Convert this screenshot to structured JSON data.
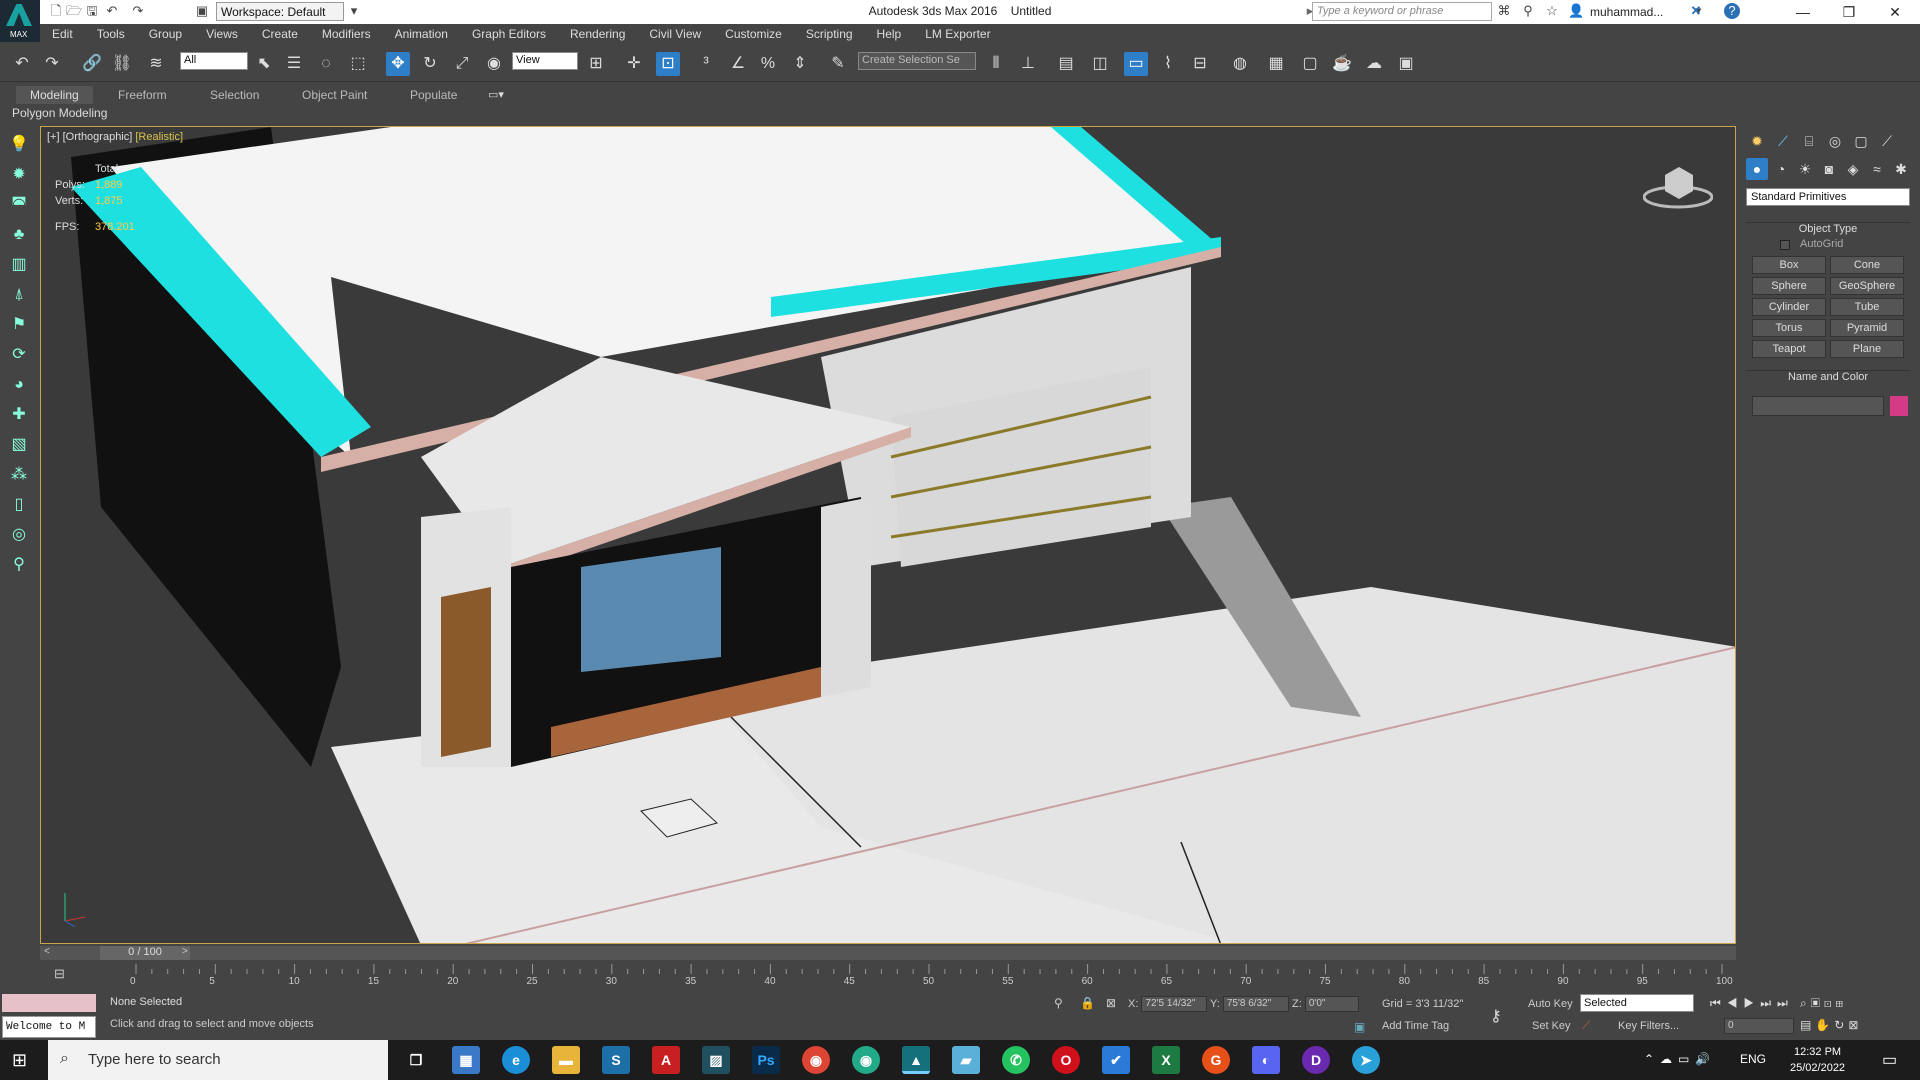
{
  "titlebar": {
    "workspace": "Workspace: Default",
    "app_name": "Autodesk 3ds Max 2016",
    "doc_name": "Untitled",
    "search_placeholder": "Type a keyword or phrase",
    "user": "muhammad...",
    "max_label": "MAX"
  },
  "menu": [
    "Edit",
    "Tools",
    "Group",
    "Views",
    "Create",
    "Modifiers",
    "Animation",
    "Graph Editors",
    "Rendering",
    "Civil View",
    "Customize",
    "Scripting",
    "Help",
    "LM Exporter"
  ],
  "toolbar": {
    "filter": "All",
    "ref_coord": "View",
    "selection_set_placeholder": "Create Selection Se"
  },
  "ribbon": {
    "tabs": [
      "Modeling",
      "Freeform",
      "Selection",
      "Object Paint",
      "Populate"
    ],
    "active": "Modeling",
    "panel": "Polygon Modeling"
  },
  "viewport": {
    "label_plus": "[+]",
    "label_view": "[Orthographic]",
    "label_shading": "[Realistic]",
    "stats": {
      "total": "Total",
      "polys_label": "Polys:",
      "polys": "1,889",
      "verts_label": "Verts:",
      "verts": "1,875",
      "fps_label": "FPS:",
      "fps": "378.201"
    }
  },
  "command_panel": {
    "category": "Standard Primitives",
    "object_type_header": "Object Type",
    "autogrid": "AutoGrid",
    "buttons": [
      "Box",
      "Cone",
      "Sphere",
      "GeoSphere",
      "Cylinder",
      "Tube",
      "Torus",
      "Pyramid",
      "Teapot",
      "Plane"
    ],
    "name_color_header": "Name and Color",
    "swatch_color": "#d43a86"
  },
  "timeline": {
    "frame": "0 / 100",
    "ticks": [
      "0",
      "5",
      "10",
      "15",
      "20",
      "25",
      "30",
      "35",
      "40",
      "45",
      "50",
      "55",
      "60",
      "65",
      "70",
      "75",
      "80",
      "85",
      "90",
      "95",
      "100"
    ]
  },
  "status": {
    "welcome": "Welcome to M",
    "selection": "None Selected",
    "hint": "Click and drag to select and move objects",
    "x_label": "X:",
    "x": "72'5 14/32\"",
    "y_label": "Y:",
    "y": "75'8 6/32\"",
    "z_label": "Z:",
    "z": "0'0\"",
    "grid": "Grid = 3'3 11/32\"",
    "add_time_tag": "Add Time Tag",
    "auto_key": "Auto Key",
    "set_key": "Set Key",
    "selected": "Selected",
    "key_filters": "Key Filters...",
    "frame_field": "0"
  },
  "taskbar": {
    "search": "Type here to search",
    "lang": "ENG",
    "time": "12:32 PM",
    "date": "25/02/2022"
  }
}
